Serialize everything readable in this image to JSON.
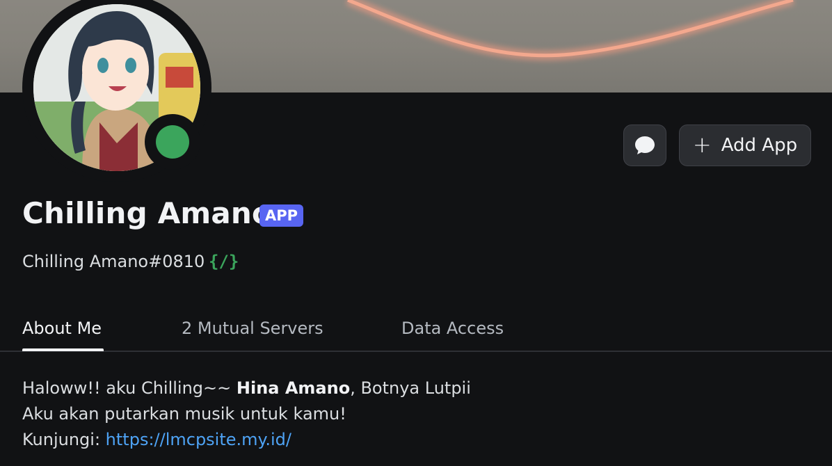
{
  "profile": {
    "display_name": "Chilling Amano",
    "badge": "APP",
    "username": "Chilling Amano#0810",
    "slash_badge": "{/}",
    "status": "online"
  },
  "actions": {
    "add_app_label": "Add App"
  },
  "tabs": [
    {
      "label": "About Me",
      "active": true
    },
    {
      "label": "2 Mutual Servers",
      "active": false
    },
    {
      "label": "Data Access",
      "active": false
    }
  ],
  "about": {
    "line1_prefix": "Haloww!! aku Chilling~~ ",
    "line1_bold": "Hina Amano",
    "line1_suffix": ", Botnya Lutpii",
    "line2": "Aku akan putarkan musik untuk kamu!",
    "line3_prefix": "Kunjungi: ",
    "link": "https://lmcpsite.my.id/"
  },
  "colors": {
    "background": "#111214",
    "accent_badge": "#5865f2",
    "status_online": "#3ba55c",
    "link": "#4ea3f5"
  }
}
